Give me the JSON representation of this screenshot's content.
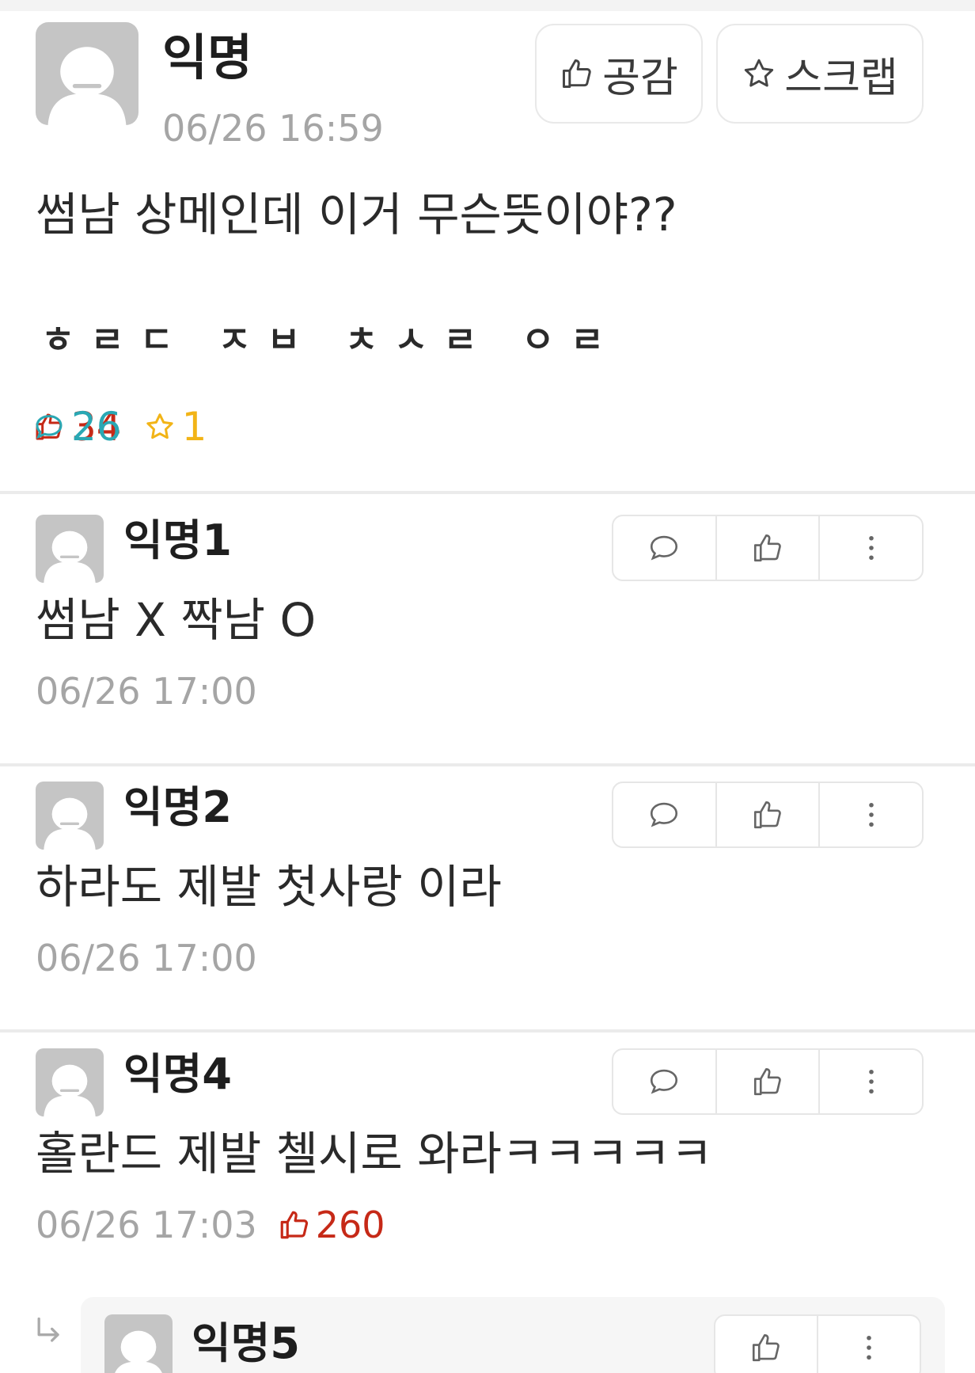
{
  "post": {
    "author": "익명",
    "time": "06/26 16:59",
    "like_button": "공감",
    "scrap_button": "스크랩",
    "title": "썸남 상메인데 이거 무슨뜻이야??",
    "body": "ㅎㄹㄷ ㅈㅂ ㅊㅅㄹ ㅇㄹ",
    "stats": {
      "votes": "34",
      "comments": "26",
      "scraps": "1"
    }
  },
  "comments": [
    {
      "author": "익명1",
      "text": "썸남 X 짝남 O",
      "time": "06/26 17:00",
      "votes": ""
    },
    {
      "author": "익명2",
      "text": "하라도 제발 첫사랑 이라",
      "time": "06/26 17:00",
      "votes": ""
    },
    {
      "author": "익명4",
      "text": "홀란드 제발 첼시로 와라ㅋㅋㅋㅋㅋ",
      "time": "06/26 17:03",
      "votes": "260"
    }
  ],
  "reply": {
    "author": "익명5"
  },
  "colors": {
    "vote": "#c62917",
    "comment": "#2aa8b4",
    "scrap": "#f2b417",
    "meta": "#a5a5a5"
  }
}
